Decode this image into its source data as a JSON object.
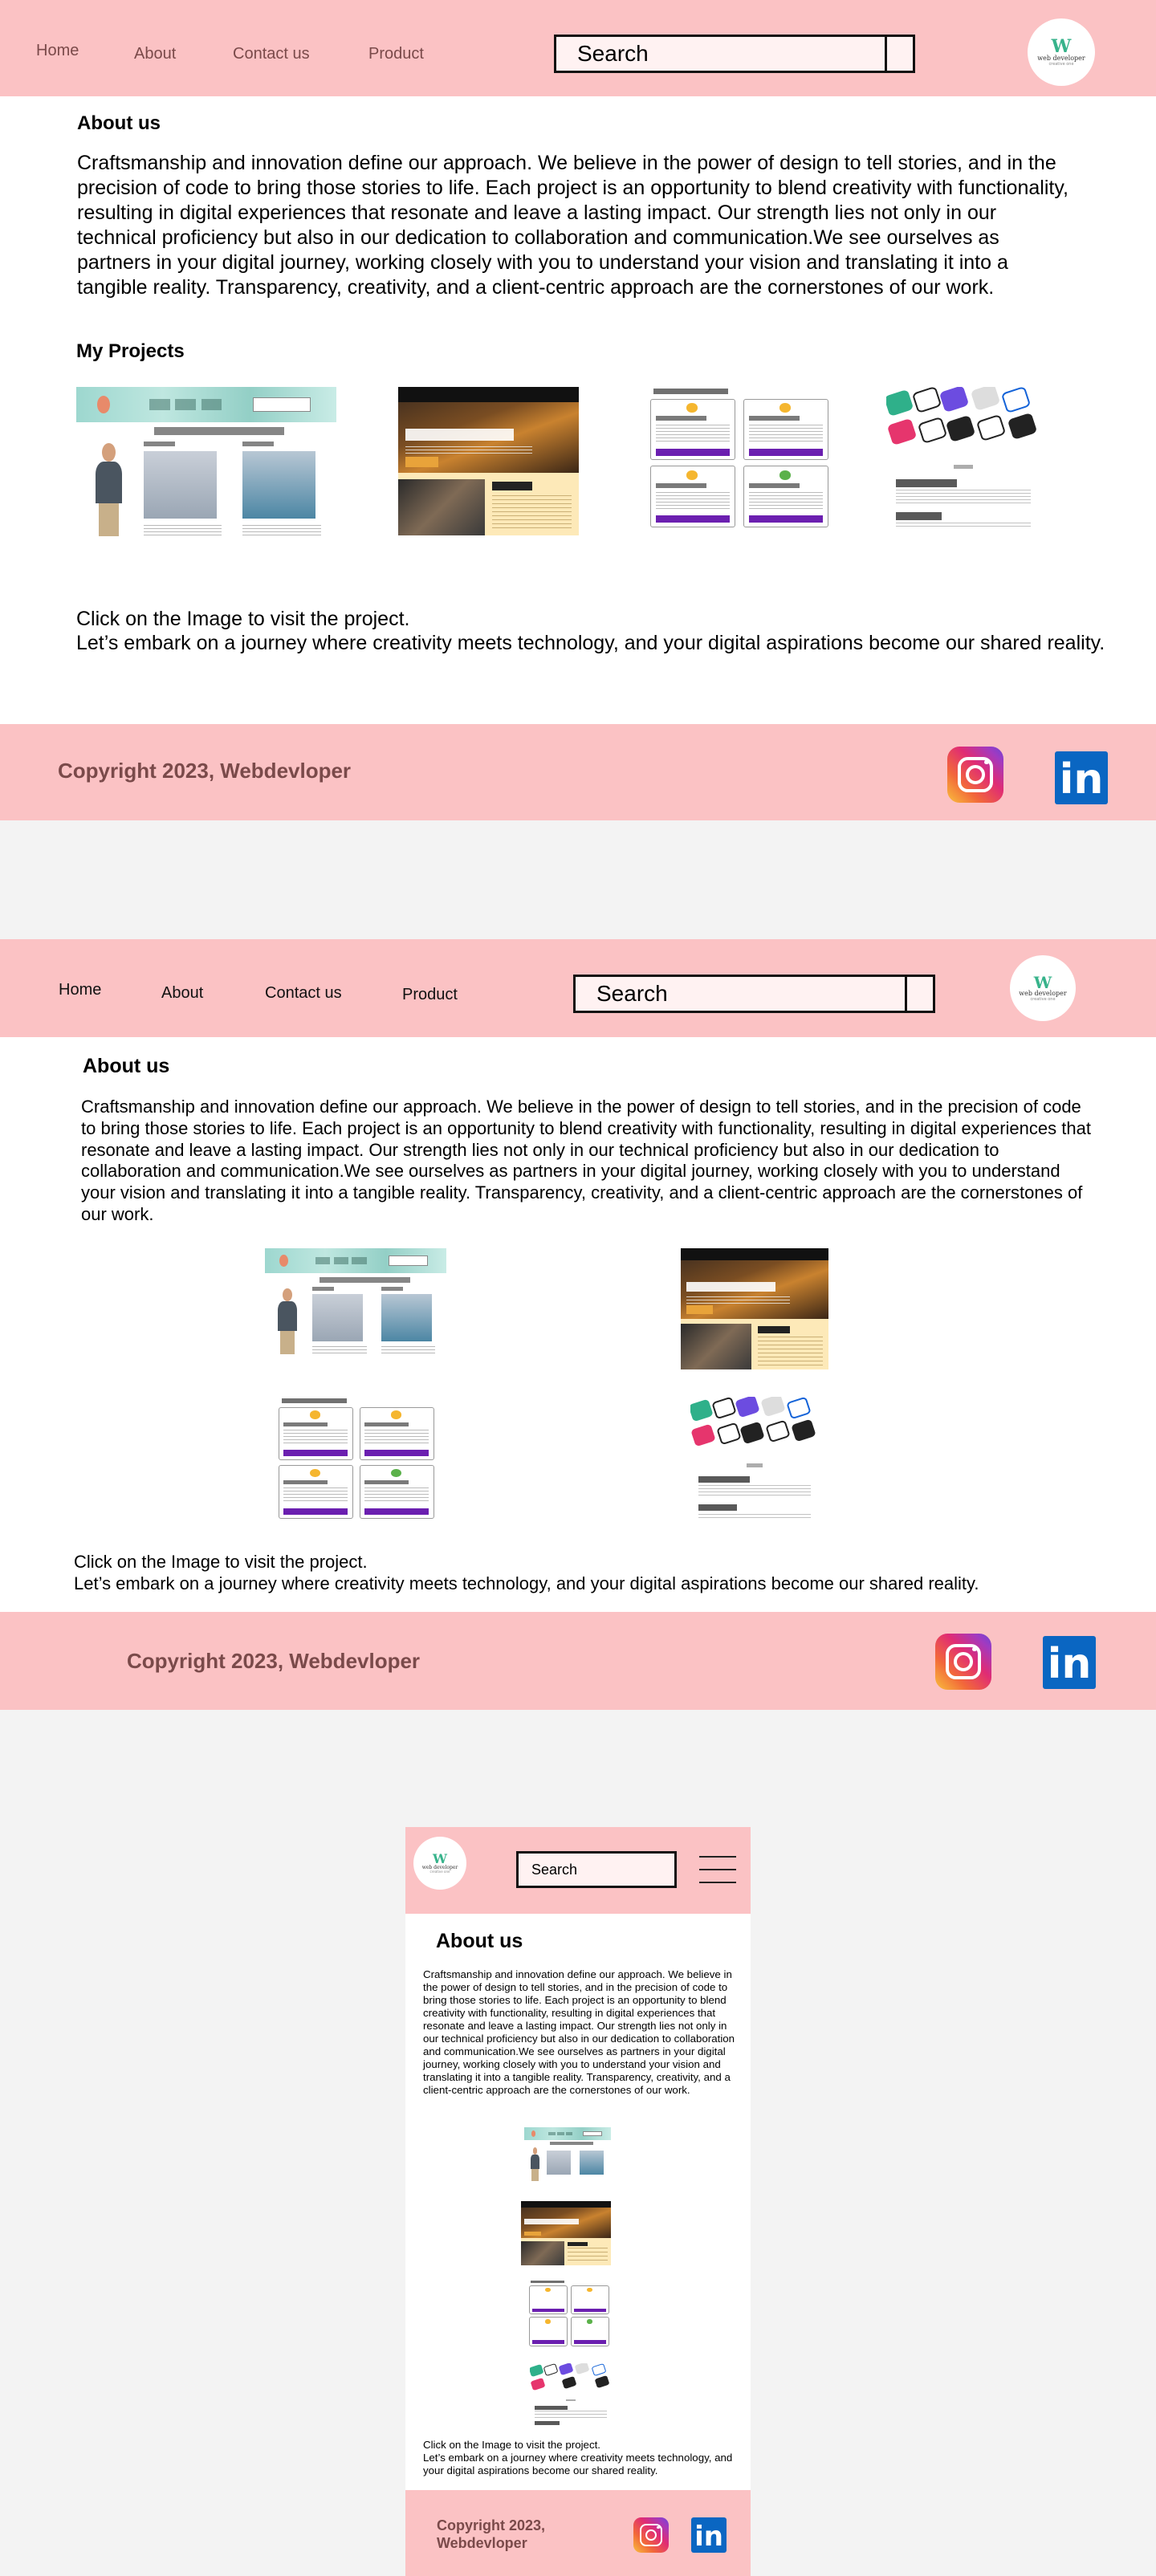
{
  "nav": {
    "home": "Home",
    "about": "About",
    "contact": "Contact us",
    "product": "Product"
  },
  "search": {
    "label": "Search",
    "placeholder": "Search"
  },
  "logo": {
    "mark": "W",
    "name": "web developer",
    "tagline": "creative one"
  },
  "about": {
    "heading": "About us",
    "text": "Craftsmanship and innovation define our approach. We believe in the power of design to tell stories, and in the precision of code to bring those stories to life. Each project is an opportunity to blend creativity with functionality, resulting in digital experiences that resonate and leave a lasting impact. Our strength lies not only in our technical proficiency but also in our dedication to collaboration and communication.We see ourselves as partners in your digital journey, working closely with you to understand your vision and translating it into a tangible reality. Transparency, creativity, and a client-centric approach are the cornerstones of our work."
  },
  "projects": {
    "heading": "My Projects",
    "items": [
      {
        "name": "baking",
        "title": "Welcome to Baking Delights",
        "labels": [
          "Classic cakes",
          "Design cakes"
        ]
      },
      {
        "name": "three-star",
        "title": "Welcome to Three Star Media",
        "labels": [
          "About Us"
        ]
      },
      {
        "name": "emojis",
        "title": "The Meaning of Emojis",
        "labels": [
          "Smiling Face with Smiling Eyes",
          "Clinking Beer Mugs",
          "Face with Tears of Joy",
          "Seedling"
        ]
      },
      {
        "name": "netcrafters",
        "title": "Home",
        "labels": [
          "About NetCrafters",
          "Our Expertise"
        ]
      }
    ]
  },
  "cta": {
    "line1": "Click on the Image to visit the project.",
    "line2": "Let’s embark on a journey where creativity meets technology, and your digital aspirations become our shared reality."
  },
  "footer": {
    "copyright": "Copyright 2023, Webdevloper",
    "copyright_line1": "Copyright 2023,",
    "copyright_line2": "Webdevloper",
    "instagram": "instagram-icon",
    "linkedin": "in"
  },
  "colors": {
    "header_bg": "#fbc2c4",
    "page_bg": "#f3f3f3",
    "linkedin": "#0a66c2",
    "footer_text": "#7a4a4a"
  }
}
